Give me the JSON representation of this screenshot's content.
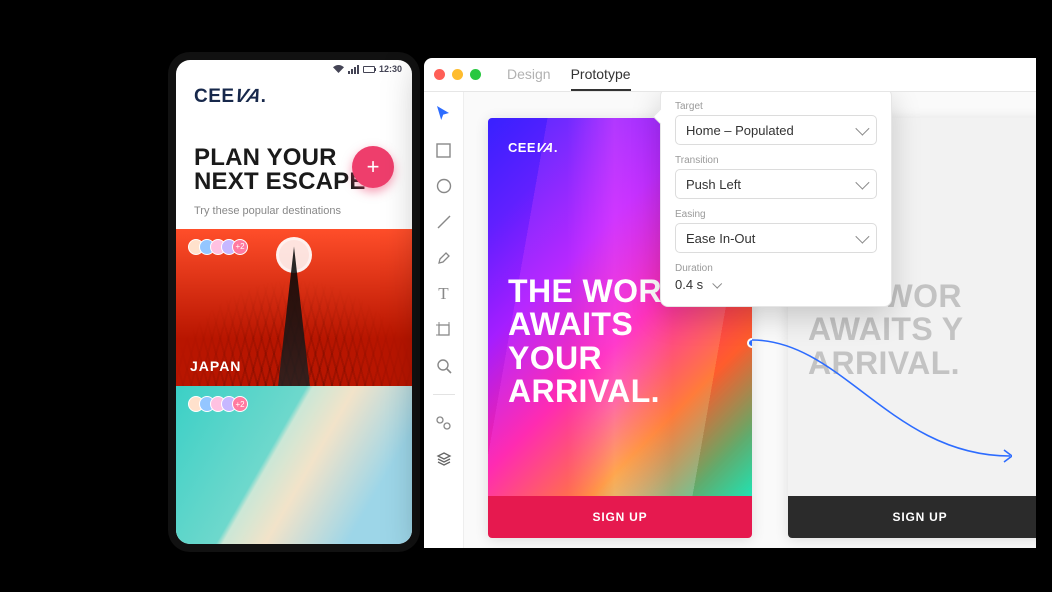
{
  "phone": {
    "status": {
      "time": "12:30"
    },
    "logo_main": "CEE",
    "logo_tilt": "VA",
    "logo_dot": ".",
    "hero_line1": "PLAN YOUR",
    "hero_line2": "NEXT ESCAPE",
    "hero_sub": "Try these popular destinations",
    "fab": "+",
    "card1_label": "JAPAN",
    "avatars_more": "+2"
  },
  "app": {
    "tabs": {
      "design": "Design",
      "prototype": "Prototype"
    },
    "panel": {
      "target_label": "Target",
      "target_value": "Home – Populated",
      "transition_label": "Transition",
      "transition_value": "Push Left",
      "easing_label": "Easing",
      "easing_value": "Ease In-Out",
      "duration_label": "Duration",
      "duration_value": "0.4 s"
    },
    "artboard": {
      "logo_main": "CEE",
      "logo_tilt": "VA",
      "logo_dot": ".",
      "headline_l1": "THE WORLD",
      "headline_l2": "AWAITS YOUR",
      "headline_l3": "ARRIVAL.",
      "cta": "SIGN UP",
      "alt_headline_l1": "THE WOR",
      "alt_headline_l2": "AWAITS Y",
      "alt_headline_l3": "ARRIVAL."
    }
  }
}
